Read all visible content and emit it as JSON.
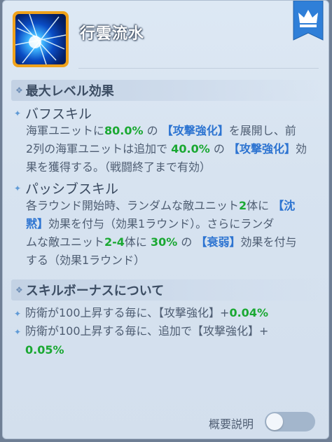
{
  "skill": {
    "title": "行雲流水",
    "icon_name": "lightning-skill-icon",
    "badge_icon": "crown-icon"
  },
  "max_level": {
    "heading": "最大レベル効果",
    "buff": {
      "heading": "バフスキル",
      "t1": "海軍ユニットに",
      "v1": "80.0%",
      "t2": "の",
      "k1": "【攻撃強化】",
      "t3": "を展開し、前",
      "t4": "2列の海軍ユニットは追加で",
      "v2": "40.0%",
      "t5": "の",
      "k2": "【攻撃強化】",
      "t6": "効",
      "t7": "果を獲得する。（戦闘終了まで有効）"
    },
    "passive": {
      "heading": "パッシブスキル",
      "t1": "各ラウンド開始時、ランダムな敵ユニット",
      "v1": "2",
      "t2": "体に",
      "k1a": "【沈",
      "k1b": "黙】",
      "t3": "効果を付与（効果1ラウンド）。さらにランダ",
      "t4": "ムな敵ユニット",
      "v2": "2-4",
      "t5": "体に",
      "v3": "30%",
      "t6": "の",
      "k2": "【衰弱】",
      "t7": "効果を付与",
      "t8": "する（効果1ラウンド）"
    }
  },
  "bonus": {
    "heading": "スキルボーナスについて",
    "line1_text": "防衛が100上昇する毎に、【攻撃強化】+",
    "line1_value": "0.04%",
    "line2_text": "防衛が100上昇する毎に、追加で【攻撃強化】+",
    "line2_value": "0.05%"
  },
  "toggle": {
    "label": "概要説明",
    "state": "off"
  },
  "colors": {
    "value_green": "#1aa832",
    "keyword_blue": "#2d74d1",
    "panel_bg": "#d7e3f0",
    "crown_ribbon": "#2f7fd8"
  }
}
